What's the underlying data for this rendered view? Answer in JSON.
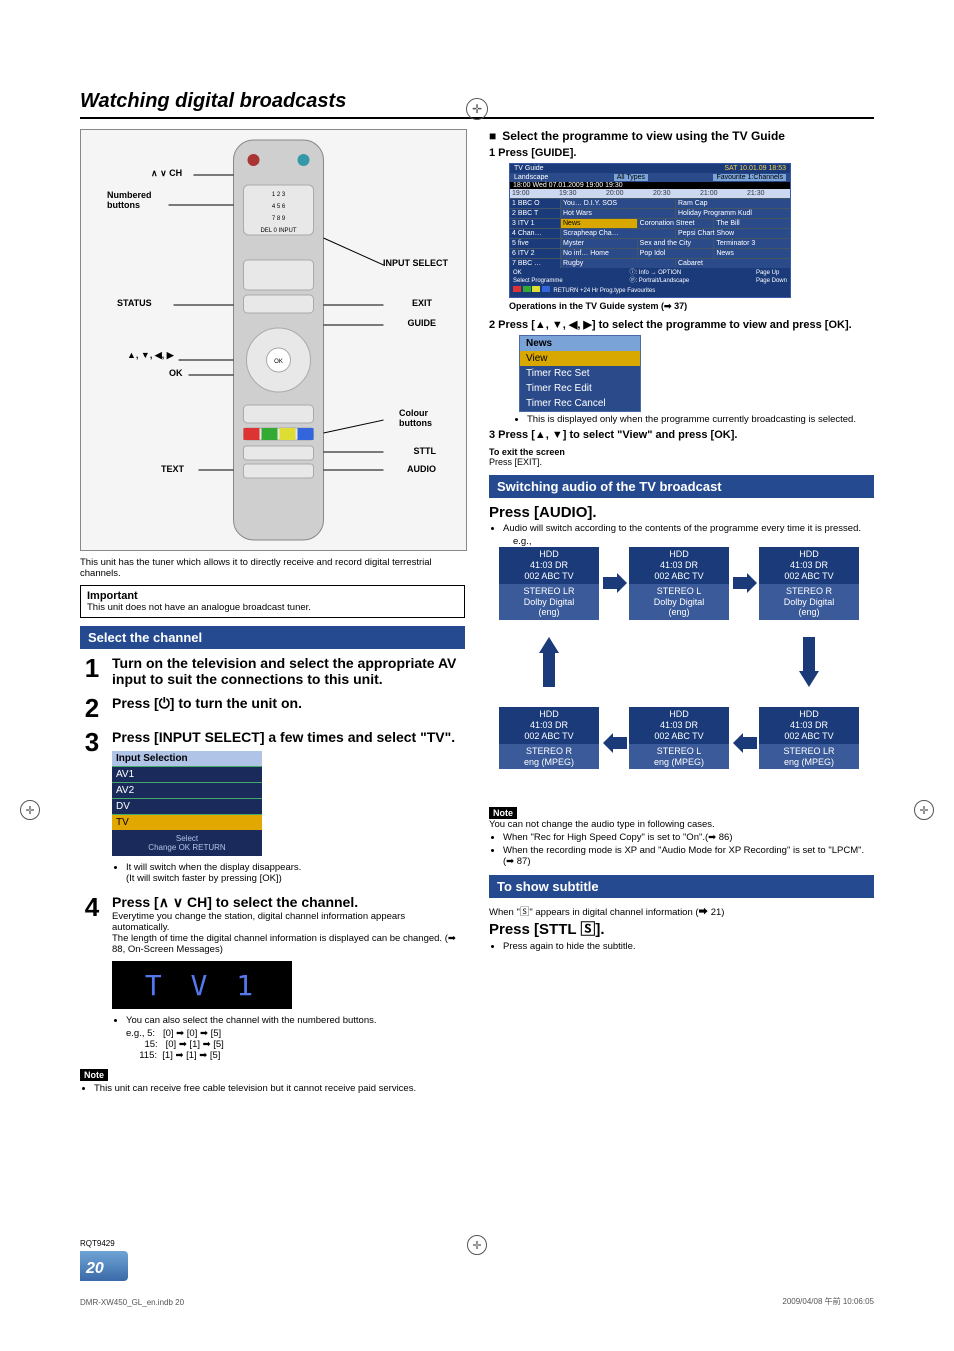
{
  "title": "Watching digital broadcasts",
  "remote": {
    "labels": {
      "ch": "∧ ∨ CH",
      "numbered": "Numbered\nbuttons",
      "input_select": "INPUT SELECT",
      "status": "STATUS",
      "exit": "EXIT",
      "guide": "GUIDE",
      "arrows": "▲, ▼, ◀, ▶",
      "ok": "OK",
      "colour": "Colour\nbuttons",
      "sttl": "STTL",
      "text": "TEXT",
      "audio": "AUDIO"
    }
  },
  "intro": "This unit has the tuner which allows it to directly receive and record digital terrestrial channels.",
  "important": {
    "label": "Important",
    "text": "This unit does not have an analogue broadcast tuner."
  },
  "section_select_channel": "Select the channel",
  "step1": {
    "num": "1",
    "head": "Turn on the television and select the appropriate AV input to suit the connections to this unit."
  },
  "step2": {
    "num": "2",
    "head_pre": "Press [",
    "head_post": "] to turn the unit on."
  },
  "step3": {
    "num": "3",
    "head": "Press [INPUT SELECT] a few times and select \"TV\".",
    "input_selection": {
      "title": "Input Selection",
      "items": [
        "AV1",
        "AV2",
        "DV",
        "TV"
      ],
      "footer_select": "Select",
      "footer_change": "Change",
      "footer_return": "RETURN"
    },
    "b1": "It will switch when the display disappears.",
    "b1_sub": "(It will switch faster by pressing [OK])"
  },
  "step4": {
    "num": "4",
    "head": "Press [∧ ∨ CH] to select the channel.",
    "p1": "Everytime you change the station, digital channel information appears automatically.",
    "p2": "The length of time the digital channel information is displayed can be changed. (➡ 88, On-Screen Messages)",
    "display": "T V   1",
    "b1": "You can also select the channel with the numbered buttons.",
    "eg_label": "e.g., 5:",
    "eg_5": "[0] ➡ [0] ➡ [5]",
    "eg_15l": "15:",
    "eg_15": "[0] ➡ [1] ➡ [5]",
    "eg_115l": "115:",
    "eg_115": "[1] ➡ [1] ➡ [5]"
  },
  "note1": {
    "label": "Note",
    "text": "This unit can receive free cable television but it cannot receive paid services."
  },
  "rcol": {
    "b_head": "Select the programme to view using the TV Guide",
    "s1": "1  Press [GUIDE].",
    "guide": {
      "title": "TV Guide",
      "date_time": "SAT 10.01.09 18:53",
      "landscape": "Landscape",
      "all_types": "All Types",
      "all_channels": "Favourite 1:Channels",
      "wed_line": "18:00 Wed 07.01.2009          19:00                    19:30",
      "times": [
        "19:00",
        "19:30",
        "20:00",
        "20:30",
        "21:00",
        "21:30"
      ],
      "rows": [
        {
          "ch": "1  BBC O",
          "p": [
            "You…  D.I.Y. SOS",
            "Ram Cap"
          ]
        },
        {
          "ch": "2  BBC T",
          "p": [
            "Hot Wars",
            "Holiday Programm  Kudl"
          ]
        },
        {
          "ch": "3  ITV 1",
          "p": [
            "News",
            "Coronation Street",
            "The Bill"
          ]
        },
        {
          "ch": "4  Chan…",
          "p": [
            "Scrapheap Cha…",
            "Pepsi Chart Show"
          ]
        },
        {
          "ch": "5  five",
          "p": [
            "Myster",
            "Sex and the City",
            "Terminator 3"
          ]
        },
        {
          "ch": "6  ITV 2",
          "p": [
            "No inf…  Home",
            "Pop Idol",
            "News"
          ]
        },
        {
          "ch": "7  BBC …",
          "p": [
            "Rugby",
            "Cabaret"
          ]
        }
      ],
      "footer1": "OK\nSelect Programme",
      "footer2": "ⓘ: Info  → OPTION\nⓟ: Portrait/Landscape",
      "footer3": "Page Up\nPage Down",
      "footer_keys": "RETURN         +24 Hr         Prog.type          Favourites"
    },
    "ops_link": "Operations in the TV Guide system (➡ 37)",
    "s2": "2  Press [▲, ▼, ◀, ▶] to select the programme to view and press [OK].",
    "ctx_menu": [
      "News",
      "View",
      "Timer Rec Set",
      "Timer Rec Edit",
      "Timer Rec Cancel"
    ],
    "ctx_note": "This is displayed only when the programme currently broadcasting is selected.",
    "s3": "3  Press [▲, ▼] to select \"View\" and press [OK].",
    "exit_h": "To exit the screen",
    "exit_t": "Press [EXIT].",
    "section_audio": "Switching audio of the TV broadcast",
    "audio_head": "Press [AUDIO].",
    "audio_p": "Audio will switch according to the contents of the programme every time it is pressed.",
    "eg": "e.g.,",
    "aud_common_top": "HDD\n41:03 DR\n002 ABC TV",
    "aud1": "STEREO LR\nDolby Digital\n(eng)",
    "aud2": "STEREO L\nDolby Digital\n(eng)",
    "aud3": "STEREO R\nDolby Digital\n(eng)",
    "aud4": "STEREO R\neng (MPEG)",
    "aud5": "STEREO L\neng (MPEG)",
    "aud6": "STEREO LR\neng (MPEG)",
    "note2_label": "Note",
    "note2_intro": "You can not change the audio type in following cases.",
    "note2_b1": "When \"Rec for High Speed Copy\" is set to \"On\".(➡ 86)",
    "note2_b2": "When the recording mode is XP and \"Audio Mode for XP Recording\" is set to \"LPCM\". (➡ 87)",
    "section_subtitle": "To show subtitle",
    "sub_p1_pre": "When \"",
    "sub_p1_post": "\" appears in digital channel information (➡ 21)",
    "sub_head": "Press [STTL 🅂].",
    "sub_b1": "Press again to hide the subtitle."
  },
  "footer": {
    "rqt": "RQT9429",
    "page": "20",
    "file": "DMR-XW450_GL_en.indb   20",
    "stamp": "2009/04/08   午前 10:06:05"
  }
}
